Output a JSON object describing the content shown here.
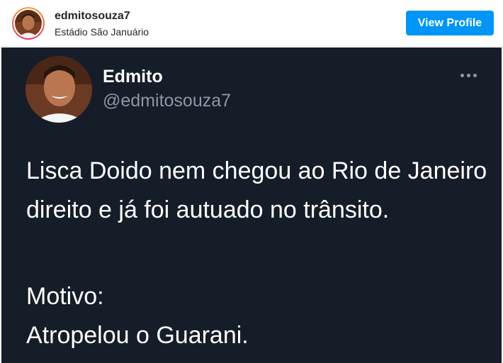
{
  "header": {
    "username": "edmitosouza7",
    "location": "Estádio São Januário",
    "view_profile_label": "View Profile"
  },
  "tweet": {
    "display_name": "Edmito",
    "handle": "@edmitosouza7",
    "text_paragraph_1": "Lisca Doido nem chegou ao Rio de Janeiro direito e já foi autuado no trânsito.",
    "text_line_2a": "Motivo:",
    "text_line_2b": "Atropelou o Guarani."
  },
  "colors": {
    "accent": "#0095f6",
    "tweet_bg": "#151d29",
    "handle": "#8b98a5"
  }
}
